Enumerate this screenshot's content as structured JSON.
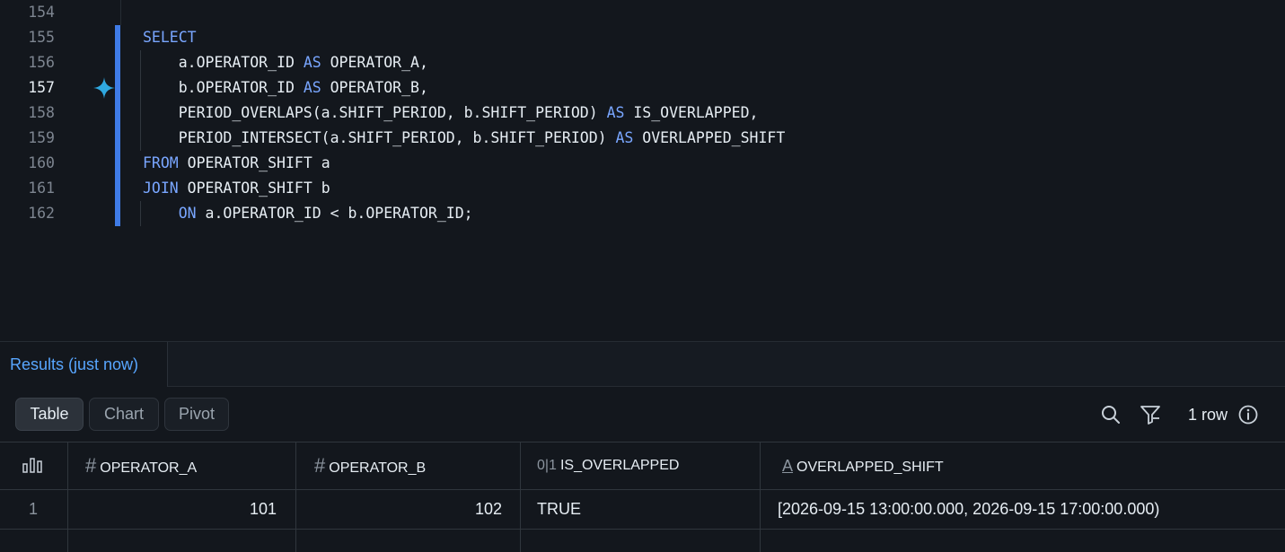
{
  "editor": {
    "lines": [
      {
        "num": "154",
        "tokens": []
      },
      {
        "num": "155",
        "tokens": [
          {
            "t": "SELECT",
            "kw": true
          }
        ]
      },
      {
        "num": "156",
        "tokens": [
          {
            "t": "    a.OPERATOR_ID "
          },
          {
            "t": "AS",
            "kw": true
          },
          {
            "t": " OPERATOR_A,"
          }
        ]
      },
      {
        "num": "157",
        "tokens": [
          {
            "t": "    b.OPERATOR_ID "
          },
          {
            "t": "AS",
            "kw": true
          },
          {
            "t": " OPERATOR_B,"
          }
        ]
      },
      {
        "num": "158",
        "tokens": [
          {
            "t": "    PERIOD_OVERLAPS(a.SHIFT_PERIOD, b.SHIFT_PERIOD) "
          },
          {
            "t": "AS",
            "kw": true
          },
          {
            "t": " IS_OVERLAPPED,"
          }
        ]
      },
      {
        "num": "159",
        "tokens": [
          {
            "t": "    PERIOD_INTERSECT(a.SHIFT_PERIOD, b.SHIFT_PERIOD) "
          },
          {
            "t": "AS",
            "kw": true
          },
          {
            "t": " OVERLAPPED_SHIFT"
          }
        ]
      },
      {
        "num": "160",
        "tokens": [
          {
            "t": "FROM",
            "kw": true
          },
          {
            "t": " OPERATOR_SHIFT a"
          }
        ]
      },
      {
        "num": "161",
        "tokens": [
          {
            "t": "JOIN",
            "kw": true
          },
          {
            "t": " OPERATOR_SHIFT b"
          }
        ]
      },
      {
        "num": "162",
        "tokens": [
          {
            "t": "    "
          },
          {
            "t": "ON",
            "kw": true
          },
          {
            "t": " a.OPERATOR_ID < b.OPERATOR_ID;"
          }
        ]
      }
    ],
    "current_line": "157",
    "ai_icon": "sparkle-icon"
  },
  "results": {
    "tab_label": "Results (just now)",
    "views": [
      {
        "label": "Table",
        "active": true
      },
      {
        "label": "Chart",
        "active": false
      },
      {
        "label": "Pivot",
        "active": false
      }
    ],
    "tools": [
      "search-icon",
      "filter-icon"
    ],
    "row_count": "1 row",
    "info_icon": "info-icon",
    "columns": [
      {
        "type_glyph": "#",
        "name": "OPERATOR_A"
      },
      {
        "type_glyph": "#",
        "name": "OPERATOR_B"
      },
      {
        "type_glyph": "0|1",
        "name": "IS_OVERLAPPED"
      },
      {
        "type_glyph": "A",
        "name": "OVERLAPPED_SHIFT"
      }
    ],
    "rows": [
      {
        "index": "1",
        "cells": [
          "101",
          "102",
          "TRUE",
          "[2026-09-15 13:00:00.000, 2026-09-15 17:00:00.000)"
        ]
      }
    ]
  },
  "colors": {
    "background": "#13171d",
    "keyword": "#79a6ff",
    "accent": "#3f7be6",
    "sparkle": "#2fa8e0",
    "link": "#58a6ff"
  }
}
